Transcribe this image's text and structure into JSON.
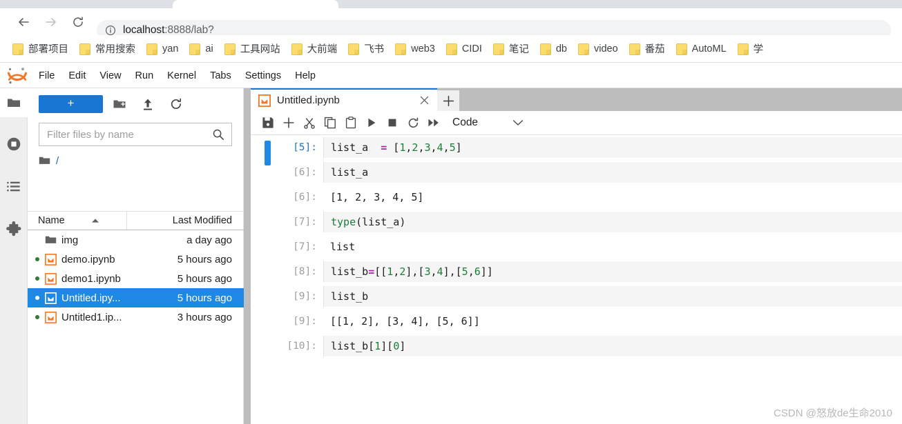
{
  "browser": {
    "back_icon": "arrow-left-icon",
    "forward_icon": "arrow-right-icon",
    "reload_icon": "reload-icon",
    "info_icon": "info-circle-icon",
    "url_host": "localhost",
    "url_rest": ":8888/lab?",
    "bookmarks": [
      {
        "label": "部署项目"
      },
      {
        "label": "常用搜索"
      },
      {
        "label": "yan"
      },
      {
        "label": "ai"
      },
      {
        "label": "工具网站"
      },
      {
        "label": "大前端"
      },
      {
        "label": "飞书"
      },
      {
        "label": "web3"
      },
      {
        "label": "CIDI"
      },
      {
        "label": "笔记"
      },
      {
        "label": "db"
      },
      {
        "label": "video"
      },
      {
        "label": "番茄"
      },
      {
        "label": "AutoML"
      },
      {
        "label": "学"
      }
    ]
  },
  "jupyter": {
    "logo_name": "jupyter-logo",
    "menu": [
      {
        "label": "File"
      },
      {
        "label": "Edit"
      },
      {
        "label": "View"
      },
      {
        "label": "Run"
      },
      {
        "label": "Kernel"
      },
      {
        "label": "Tabs"
      },
      {
        "label": "Settings"
      },
      {
        "label": "Help"
      }
    ],
    "rail": [
      {
        "name": "file-browser-icon",
        "active": true
      },
      {
        "name": "running-terminals-icon",
        "active": false
      },
      {
        "name": "commands-list-icon",
        "active": false
      },
      {
        "name": "extension-manager-icon",
        "active": false
      }
    ],
    "filebrowser": {
      "new_launcher_label": "+",
      "new_folder_icon": "new-folder-icon",
      "upload_icon": "upload-icon",
      "refresh_icon": "refresh-icon",
      "filter_placeholder": "Filter files by name",
      "search_icon": "search-icon",
      "breadcrumb_root": "/",
      "columns": {
        "name": "Name",
        "last_modified": "Last Modified"
      },
      "sort_caret": "caret-up-icon",
      "items": [
        {
          "name": "img",
          "modified": "a day ago",
          "kind": "folder",
          "running": false,
          "selected": false
        },
        {
          "name": "demo.ipynb",
          "modified": "5 hours ago",
          "kind": "notebook",
          "running": true,
          "selected": false
        },
        {
          "name": "demo1.ipynb",
          "modified": "5 hours ago",
          "kind": "notebook",
          "running": true,
          "selected": false
        },
        {
          "name": "Untitled.ipy...",
          "modified": "5 hours ago",
          "kind": "notebook",
          "running": true,
          "selected": true
        },
        {
          "name": "Untitled1.ip...",
          "modified": "3 hours ago",
          "kind": "notebook",
          "running": true,
          "selected": false
        }
      ]
    },
    "dock": {
      "tab_label": "Untitled.ipynb",
      "tab_icon": "notebook-icon",
      "close_icon": "close-icon",
      "add_tab_label": "+"
    },
    "notebook_toolbar": {
      "save_icon": "save-icon",
      "insert_icon": "plus-icon",
      "cut_icon": "scissors-icon",
      "copy_icon": "copy-icon",
      "paste_icon": "paste-icon",
      "run_icon": "play-icon",
      "stop_icon": "stop-icon",
      "restart_icon": "restart-icon",
      "restart_run_all_icon": "fast-forward-icon",
      "celltype_value": "Code",
      "celltype_caret": "chevron-down-icon"
    },
    "cells": [
      {
        "type": "input",
        "prompt": "[5]:",
        "active": true,
        "code_html": "list_a  <span class=\"tok-op\">=</span> [<span class=\"tok-num\">1</span>,<span class=\"tok-num\">2</span>,<span class=\"tok-num\">3</span>,<span class=\"tok-num\">4</span>,<span class=\"tok-num\">5</span>]"
      },
      {
        "type": "input",
        "prompt": "[6]:",
        "active": false,
        "code_html": "list_a"
      },
      {
        "type": "output",
        "prompt": "[6]:",
        "active": false,
        "code_html": "[1, 2, 3, 4, 5]"
      },
      {
        "type": "input",
        "prompt": "[7]:",
        "active": false,
        "code_html": "<span class=\"tok-fn\">type</span>(list_a)"
      },
      {
        "type": "output",
        "prompt": "[7]:",
        "active": false,
        "code_html": "list"
      },
      {
        "type": "input",
        "prompt": "[8]:",
        "active": false,
        "code_html": "list_b<span class=\"tok-op\">=</span>[[<span class=\"tok-num\">1</span>,<span class=\"tok-num\">2</span>],[<span class=\"tok-num\">3</span>,<span class=\"tok-num\">4</span>],[<span class=\"tok-num\">5</span>,<span class=\"tok-num\">6</span>]]"
      },
      {
        "type": "input",
        "prompt": "[9]:",
        "active": false,
        "code_html": "list_b"
      },
      {
        "type": "output",
        "prompt": "[9]:",
        "active": false,
        "code_html": "[[1, 2], [3, 4], [5, 6]]"
      },
      {
        "type": "input",
        "prompt": "[10]:",
        "active": false,
        "code_html": "list_b[<span class=\"tok-num\">1</span>][<span class=\"tok-num\">0</span>]"
      }
    ]
  },
  "watermark": "CSDN @怒放de生命2010",
  "colors": {
    "accent_blue": "#1976d2",
    "select_blue": "#1e88e5",
    "jupyter_orange": "#f37726",
    "bookmark_yellow": "#fcdc6d",
    "kernel_green": "#2e7d32"
  }
}
